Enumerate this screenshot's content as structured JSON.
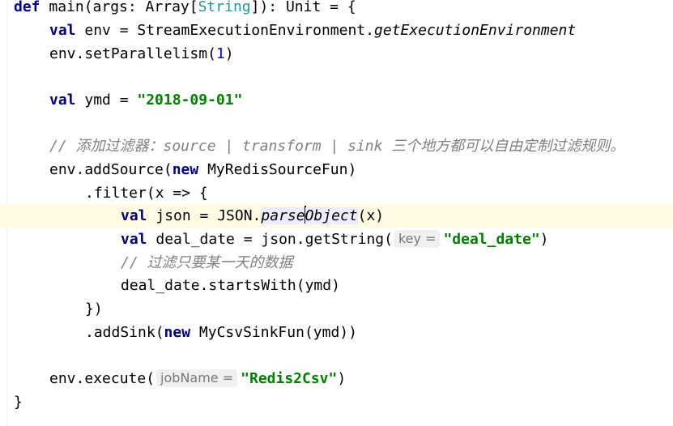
{
  "code": {
    "l1": {
      "kw": "def",
      "text1": " main(args: Array[",
      "type_param": "String",
      "text2": "]): Unit = {"
    },
    "l2": {
      "kw": "val",
      "text1": " env = StreamExecutionEnvironment.",
      "method": "getExecutionEnvironment"
    },
    "l3": {
      "text1": "env.setParallelism(",
      "num": "1",
      "text2": ")"
    },
    "l5": {
      "kw": "val",
      "text1": " ymd = ",
      "str": "\"2018-09-01\""
    },
    "l7": {
      "comment": "// 添加过滤器：source | transform | sink 三个地方都可以自由定制过滤规则。"
    },
    "l8": {
      "text1": "env.addSource(",
      "kw": "new",
      "text2": " MyRedisSourceFun)"
    },
    "l9": {
      "text1": ".filter(x => {"
    },
    "l10": {
      "kw": "val",
      "text1": " json = JSON.",
      "method_a": "parse",
      "method_b": "Object",
      "text2": "(x)"
    },
    "l11": {
      "kw": "val",
      "text1": " deal_date = json.getString(",
      "hint": "key =",
      "str": "\"deal_date\"",
      "text2": ")"
    },
    "l12": {
      "comment": "// 过滤只要某一天的数据"
    },
    "l13": {
      "text1": "deal_date.startsWith(ymd)"
    },
    "l14": {
      "text1": "})"
    },
    "l15": {
      "text1": ".addSink(",
      "kw": "new",
      "text2": " MyCsvSinkFun(ymd))"
    },
    "l17": {
      "text1": "env.execute(",
      "hint": "jobName =",
      "str": "\"Redis2Csv\"",
      "text2": ")"
    },
    "l18": {
      "text1": "}"
    }
  }
}
